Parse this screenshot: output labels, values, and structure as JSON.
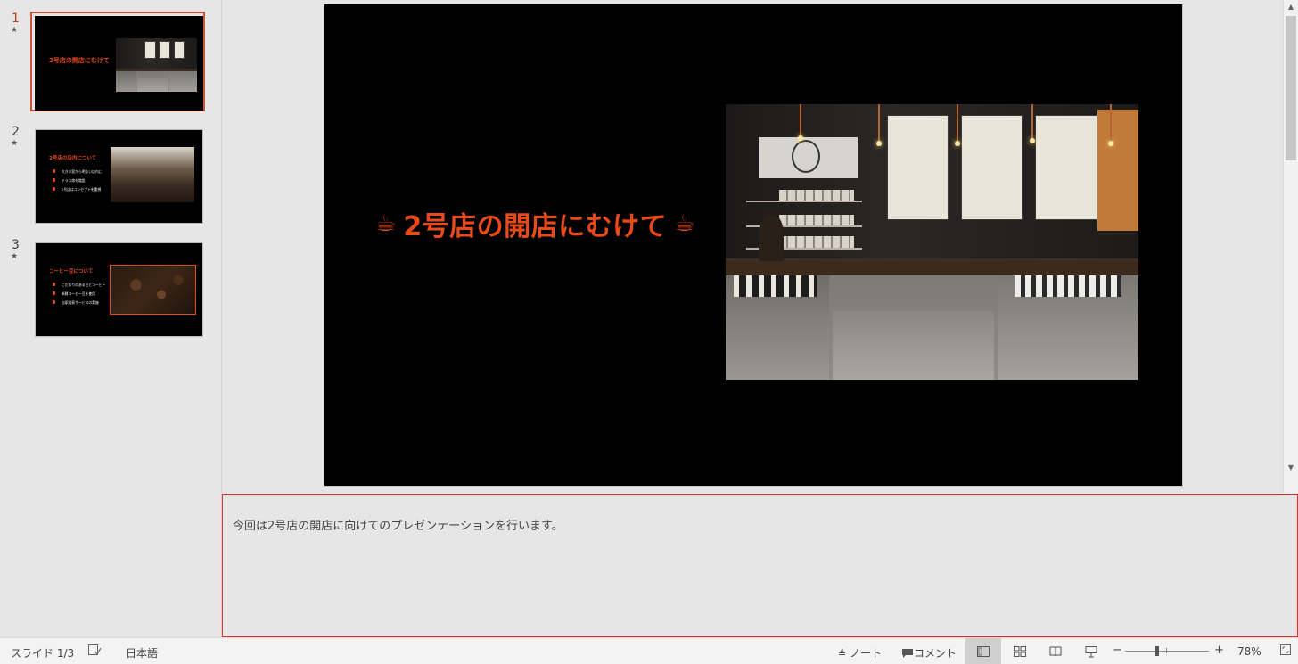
{
  "thumbnails": [
    {
      "number": "1",
      "title": "2号店の開店にむけて",
      "bullets": []
    },
    {
      "number": "2",
      "title": "2号店の店内について",
      "bullets": [
        "大きい窓から明るい店内に",
        "テラス席を増設",
        "2号店はコンセプトを重視"
      ]
    },
    {
      "number": "3",
      "title": "コーヒー豆について",
      "bullets": [
        "こだわりのある豆とコーヒー",
        "新鮮コーヒー豆を使用",
        "自家焙煎サービスの実施"
      ]
    }
  ],
  "slide": {
    "title": "2号店の開店にむけて",
    "cup_icon": "coffee-cup-icon"
  },
  "notes": {
    "text": "今回は2号店の開店に向けてのプレゼンテーションを行います。"
  },
  "statusbar": {
    "slide_counter": "スライド 1/3",
    "language": "日本語",
    "notes_label": "ノート",
    "comments_label": "コメント",
    "zoom_minus": "−",
    "zoom_plus": "+",
    "zoom_level": "78%"
  },
  "colors": {
    "accent": "#e84a1a",
    "selection": "#c9553a",
    "notes_border": "#e0302a"
  }
}
